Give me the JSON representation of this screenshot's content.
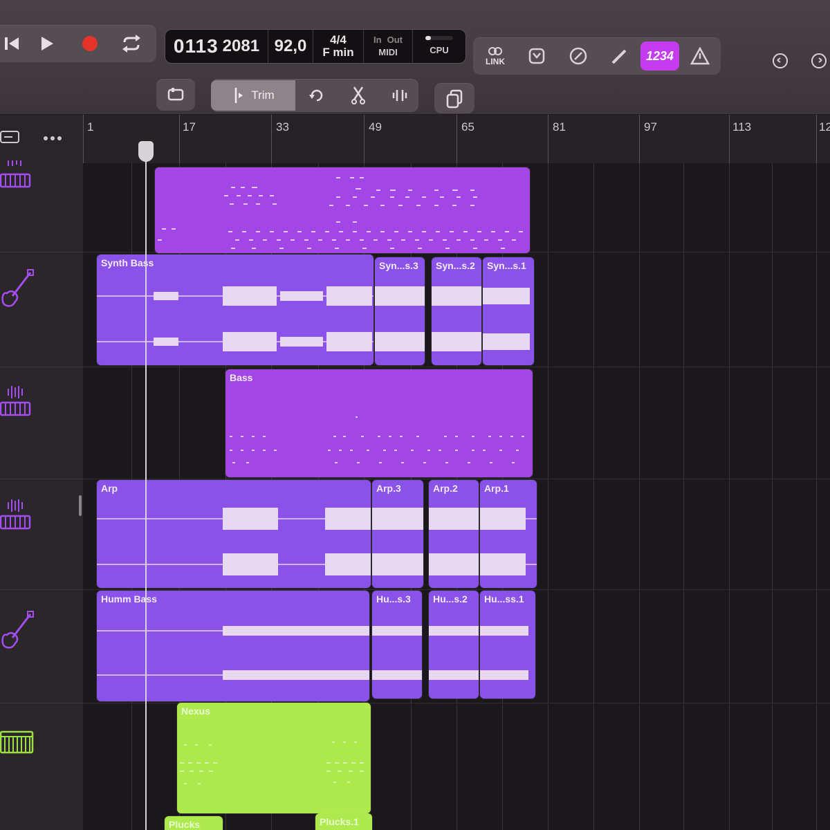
{
  "transport": {
    "position_bars": "0113",
    "position_ticks": "2081",
    "tempo": "92,0",
    "time_signature": "4/4",
    "key": "F min",
    "midi_in_label": "In",
    "midi_out_label": "Out",
    "midi_label": "MIDI",
    "cpu_label": "CPU",
    "rewind_icon": "rewind-icon",
    "play_icon": "play-icon",
    "record_icon": "record-icon",
    "cycle_icon": "cycle-icon"
  },
  "toolbar_right": {
    "link_label": "LINK",
    "mode_label": "1234",
    "undo_icon": "undo-icon",
    "redo_icon": "redo-icon"
  },
  "tools": {
    "trim_label": "Trim"
  },
  "ruler": {
    "bars": [
      "1",
      "17",
      "33",
      "49",
      "65",
      "81",
      "97",
      "113",
      "12"
    ]
  },
  "tracks": [
    {
      "icon": "keyboard-icon"
    },
    {
      "icon": "guitar-icon"
    },
    {
      "icon": "keyboard-icon"
    },
    {
      "icon": "keyboard-icon"
    },
    {
      "icon": "guitar-icon"
    },
    {
      "icon": "keyboard-icon"
    }
  ],
  "regions": {
    "synth_bass": "Synth Bass",
    "synth_bass_3": "Syn...s.3",
    "synth_bass_2": "Syn...s.2",
    "synth_bass_1": "Syn...s.1",
    "bass": "Bass",
    "arp": "Arp",
    "arp_3": "Arp.3",
    "arp_2": "Arp.2",
    "arp_1": "Arp.1",
    "humm_bass": "Humm Bass",
    "humm_bass_3": "Hu...s.3",
    "humm_bass_2": "Hu...s.2",
    "humm_bass_1": "Hu...ss.1",
    "nexus": "Nexus",
    "plucks": "Plucks",
    "plucks_1": "Plucks.1"
  },
  "colors": {
    "audio_region": "#8a52e8",
    "midi_region": "#a246e6",
    "nexus_region": "#aee94e",
    "mode_active": "#c43bf0",
    "record": "#e5332a"
  }
}
